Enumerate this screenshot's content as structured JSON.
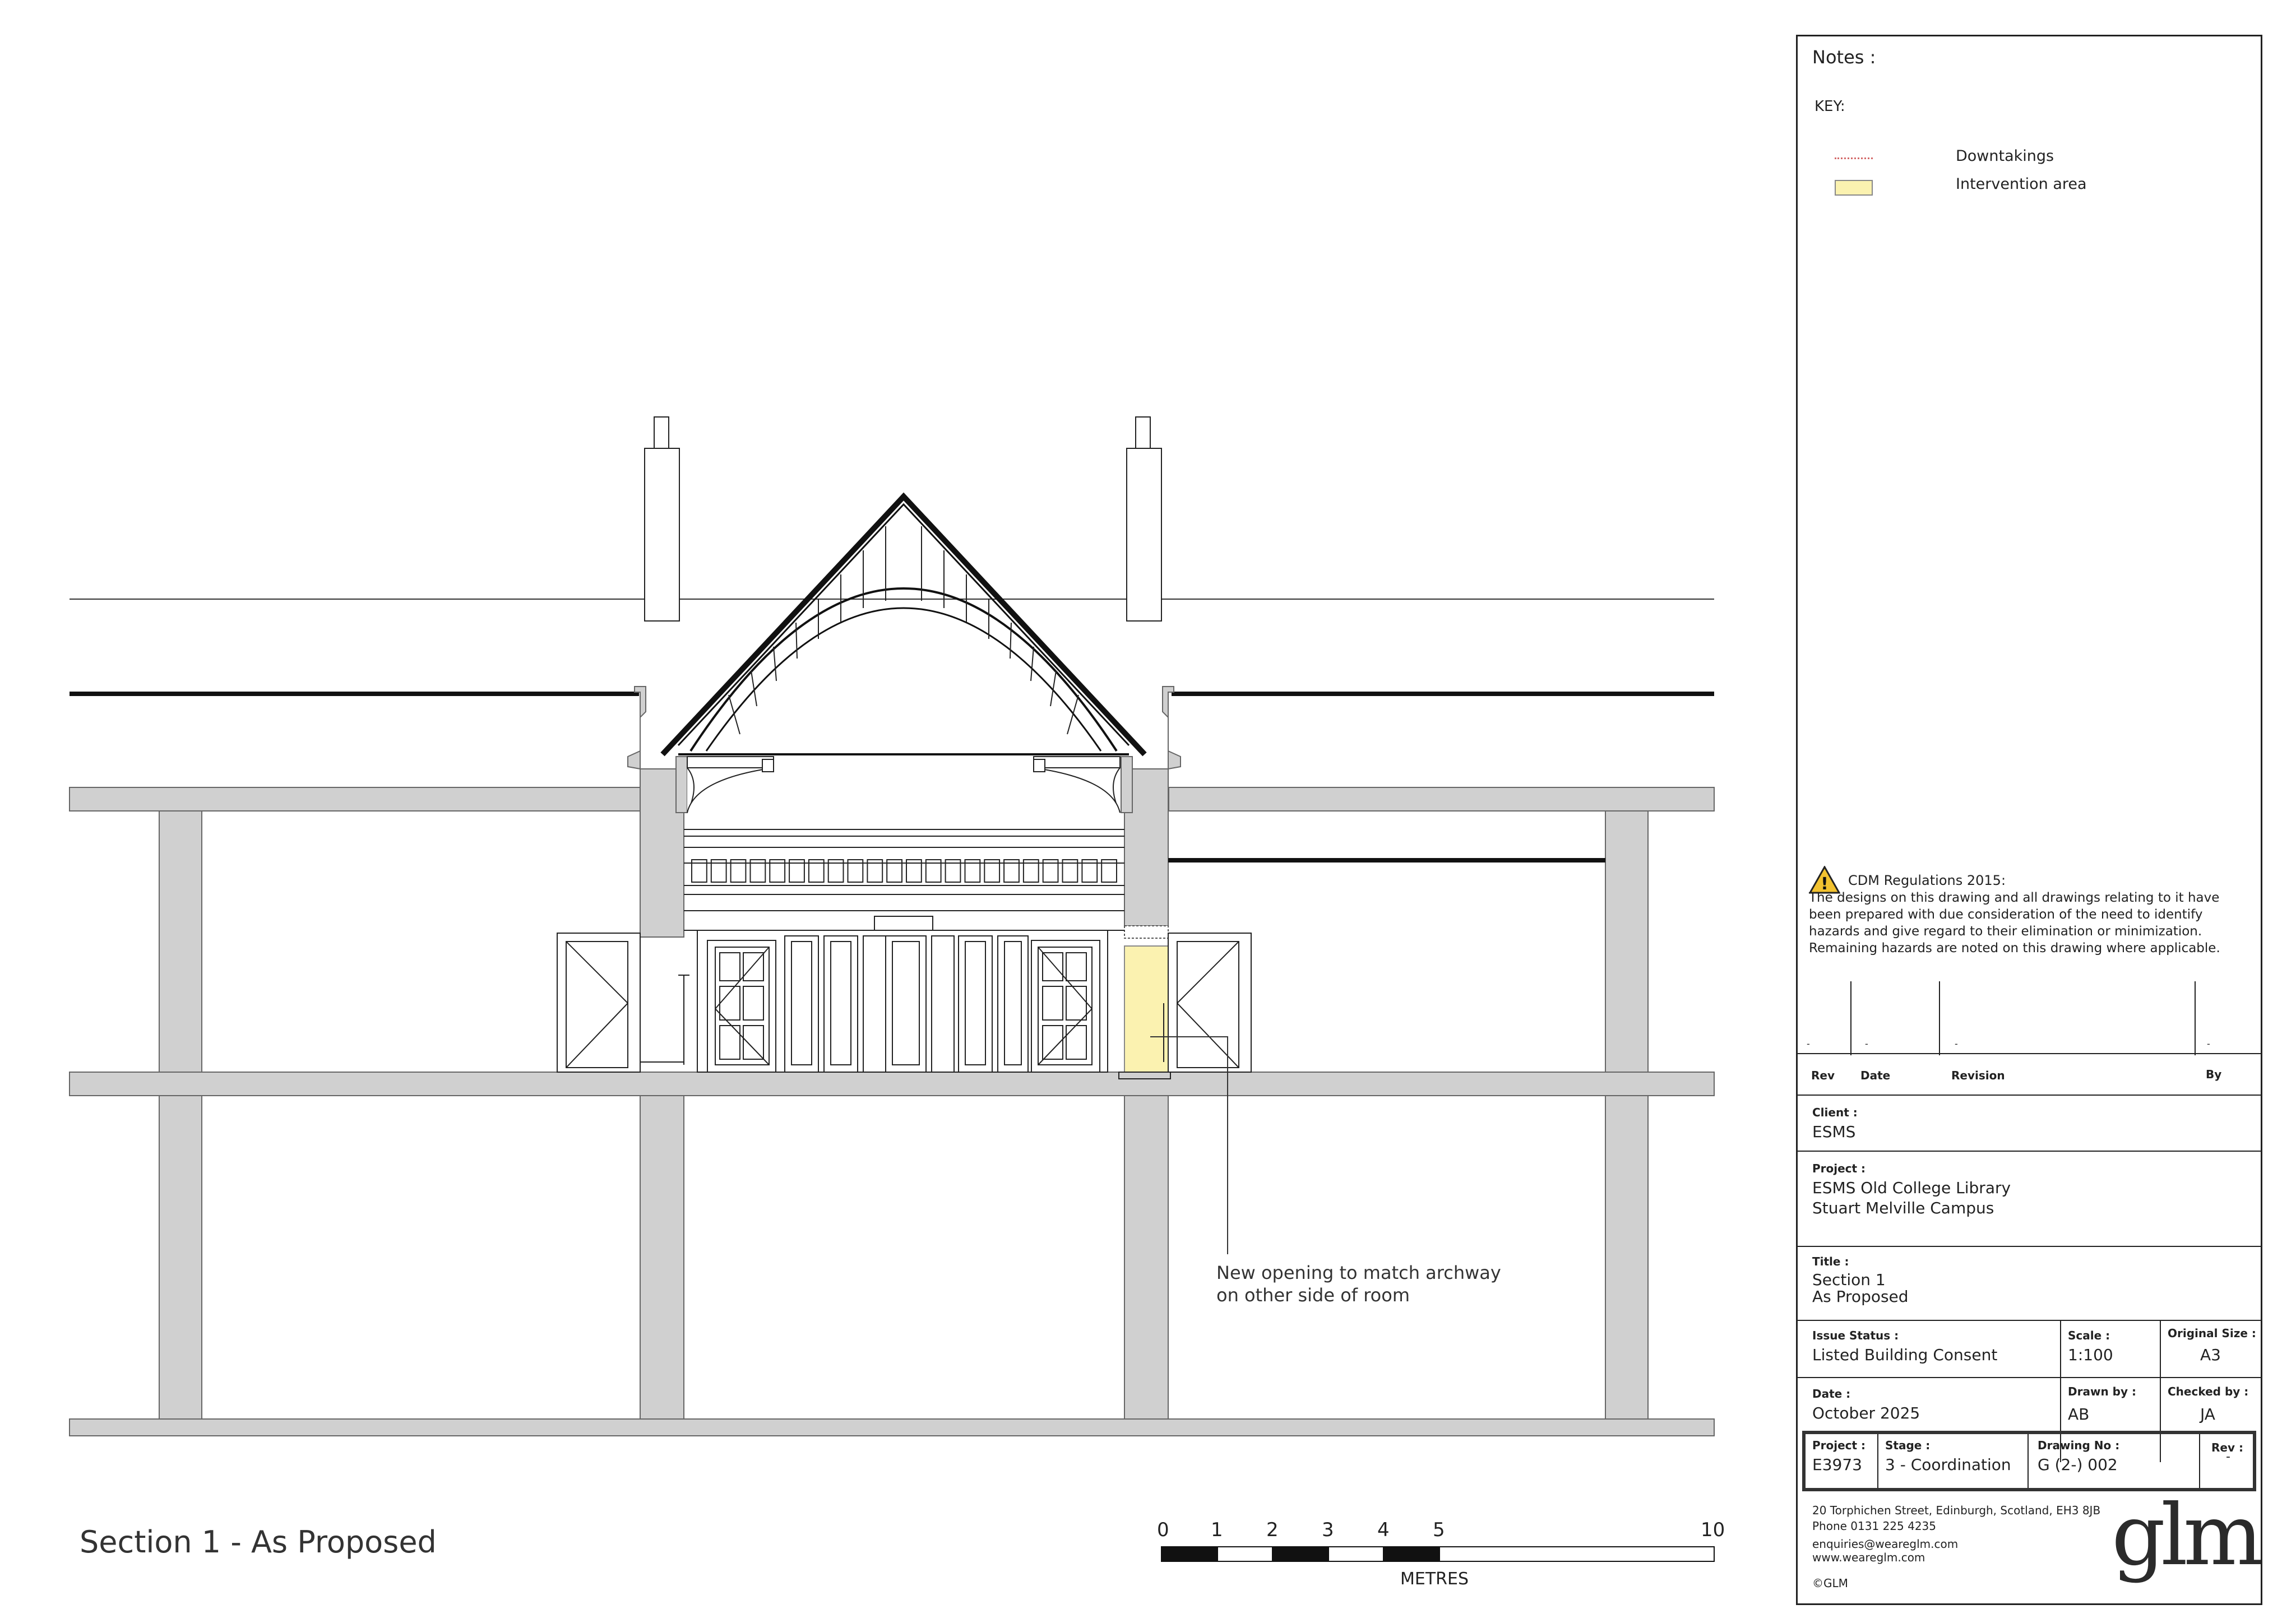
{
  "drawing_title": "Section 1 - As Proposed",
  "annotation": {
    "line1": "New opening to match archway",
    "line2": "on other side of room"
  },
  "scale_bar": {
    "ticks": [
      "0",
      "1",
      "2",
      "3",
      "4",
      "5",
      "10"
    ],
    "unit": "METRES"
  },
  "notes": {
    "heading": "Notes :",
    "key_heading": "KEY:",
    "key_items": [
      {
        "label": "Downtakings",
        "icon": "dotted-red-line"
      },
      {
        "label": "Intervention area",
        "icon": "yellow-swatch",
        "color": "#fbf2b0"
      }
    ]
  },
  "cdm": {
    "title": "CDM Regulations 2015:",
    "lines": [
      "The designs on this drawing and all drawings relating to it have",
      "been prepared with due consideration of the need to identify",
      "hazards and give regard to their elimination or minimization.",
      "Remaining hazards are noted on this drawing where applicable."
    ]
  },
  "revision_table": {
    "headers": [
      "Rev",
      "Date",
      "Revision",
      "By"
    ],
    "row": [
      "-",
      "-",
      "-",
      "-"
    ]
  },
  "client": {
    "label": "Client :",
    "value": "ESMS"
  },
  "project": {
    "label": "Project :",
    "line1": "ESMS Old College Library",
    "line2": "Stuart Melville Campus"
  },
  "title": {
    "label": "Title :",
    "line1": "Section 1",
    "line2": "As Proposed"
  },
  "issue_status": {
    "label": "Issue Status :",
    "value": "Listed Building Consent"
  },
  "scale": {
    "label": "Scale :",
    "value": "1:100"
  },
  "original_size": {
    "label": "Original Size :",
    "value": "A3"
  },
  "date": {
    "label": "Date :",
    "value": "October 2025"
  },
  "drawn_by": {
    "label": "Drawn by :",
    "value": "AB"
  },
  "checked_by": {
    "label": "Checked by :",
    "value": "JA"
  },
  "project_no": {
    "label": "Project :",
    "value": "E3973"
  },
  "stage": {
    "label": "Stage :",
    "value": "3 - Coordination"
  },
  "drawing_no": {
    "label": "Drawing No :",
    "value": "G (2-) 002"
  },
  "rev": {
    "label": "Rev :",
    "value": "-"
  },
  "footer": {
    "address": "20 Torphichen Street, Edinburgh, Scotland, EH3 8JB",
    "phone": "Phone 0131 225 4235",
    "email": "enquiries@weareglm.com",
    "web": "www.weareglm.com",
    "copyright": "©GLM",
    "logo": "glm"
  },
  "colors": {
    "wall": "#d0d0d0",
    "intervention": "#fbf2b0",
    "line": "#222222"
  }
}
